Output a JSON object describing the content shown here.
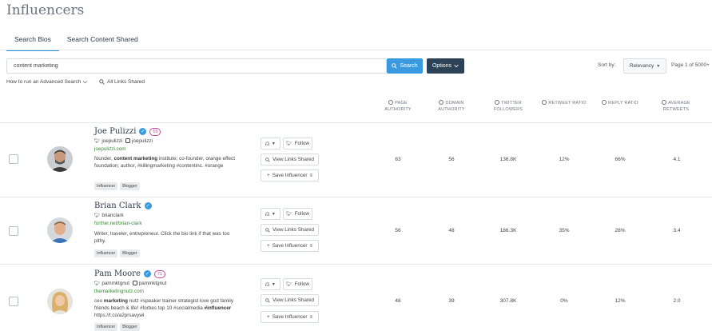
{
  "page_title": "Influencers",
  "tabs": [
    {
      "label": "Search Bios",
      "active": true
    },
    {
      "label": "Search Content Shared",
      "active": false
    }
  ],
  "search": {
    "value": "content marketing",
    "button_label": "Search",
    "options_label": "Options"
  },
  "sort": {
    "label": "Sort by:",
    "selected": "Relevancy",
    "page_info": "Page 1 of 5000+"
  },
  "links": {
    "advanced_search": "How to run an Advanced Search",
    "all_links_shared": "All Links Shared"
  },
  "columns": [
    {
      "line1": "PAGE",
      "line2": "AUTHORITY"
    },
    {
      "line1": "DOMAIN",
      "line2": "AUTHORITY"
    },
    {
      "line1": "TWITTER",
      "line2": "FOLLOWERS"
    },
    {
      "line1": "RETWEET RATIO",
      "line2": ""
    },
    {
      "line1": "REPLY RATIO",
      "line2": ""
    },
    {
      "line1": "AVERAGE",
      "line2": "RETWEETS"
    }
  ],
  "actions": {
    "follow": "Follow",
    "view_links": "View Links Shared",
    "save": "Save Influencer"
  },
  "influencers": [
    {
      "name": "Joe Pulizzi",
      "score": "69",
      "twitter": "joepulizzi",
      "instagram": "joepulizzi",
      "website": "joepulizzi.com",
      "bio_parts": [
        "founder, ",
        "content marketing",
        " institute; co-founder, orange effect foundation; author, #killingmarketing #contentinc. #orange"
      ],
      "tags": [
        "Influencer",
        "Blogger"
      ],
      "page_authority": "63",
      "domain_authority": "56",
      "twitter_followers": "136.8K",
      "retweet_ratio": "12%",
      "reply_ratio": "66%",
      "average_retweets": "4.1"
    },
    {
      "name": "Brian Clark",
      "score": "",
      "twitter": "brianclark",
      "instagram": "",
      "website": "further.net/brian-clark",
      "bio_parts": [
        "Writer, traveler, entrepreneur. Click the bio link if that was too pithy.",
        "",
        ""
      ],
      "tags": [
        "Influencer",
        "Blogger"
      ],
      "page_authority": "56",
      "domain_authority": "48",
      "twitter_followers": "186.3K",
      "retweet_ratio": "35%",
      "reply_ratio": "28%",
      "average_retweets": "3.4"
    },
    {
      "name": "Pam Moore",
      "score": "71",
      "twitter": "pammktgnut",
      "instagram": "pammktgnut",
      "website": "themarketingnutz.com",
      "bio_parts": [
        "ceo ",
        "marketing",
        " nutz #speaker trainer strategist love god family friends beach & life! #forbes top 10 #socialmedia "
      ],
      "bio_bold2": "#influencer",
      "bio_tail": " https://t.co/a2prsavywl",
      "tags": [
        "Influencer",
        "Blogger"
      ],
      "page_authority": "48",
      "domain_authority": "39",
      "twitter_followers": "307.8K",
      "retweet_ratio": "0%",
      "reply_ratio": "12%",
      "average_retweets": "2.0"
    }
  ],
  "colors": {
    "accent": "#3a9ae0",
    "dark_button": "#2c4256",
    "score_badge": "#c84a9a",
    "website_green": "#3a8a3a"
  }
}
